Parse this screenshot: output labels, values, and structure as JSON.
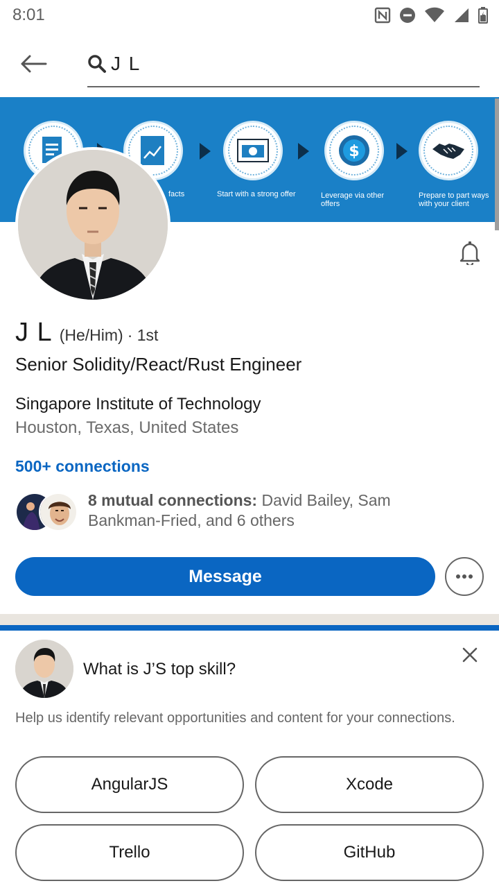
{
  "status_bar": {
    "time": "8:01",
    "icons": [
      "nfc-icon",
      "do-not-disturb-icon",
      "wifi-icon",
      "cell-signal-icon",
      "battery-icon"
    ]
  },
  "search": {
    "query": "J L",
    "icon": "search-icon",
    "back_icon": "back-arrow-icon"
  },
  "banner": {
    "captions": [
      "facts",
      "Start with a strong offer",
      "Leverage via other offers",
      "Prepare to part ways with your client"
    ]
  },
  "profile": {
    "name": "J L",
    "pronouns": "(He/Him)",
    "degree": "· 1st",
    "headline": "Senior Solidity/React/Rust Engineer",
    "school": "Singapore Institute of Technology",
    "location": "Houston, Texas, United States",
    "connections": "500+ connections",
    "mutual_label": "8 mutual connections:",
    "mutual_names": " David Bailey, Sam Bankman-Fried, and 6 others",
    "message_label": "Message",
    "more_icon": "more-horizontal-icon",
    "bell_icon": "bell-icon"
  },
  "skill_prompt": {
    "question": "What is J’S top skill?",
    "help": "Help us identify relevant opportunities and content for your connections.",
    "options": [
      "AngularJS",
      "Xcode",
      "Trello",
      "GitHub"
    ],
    "close_icon": "close-icon"
  },
  "colors": {
    "accent": "#0a66c2",
    "banner": "#1a80c7",
    "divider": "#e9e5df"
  }
}
